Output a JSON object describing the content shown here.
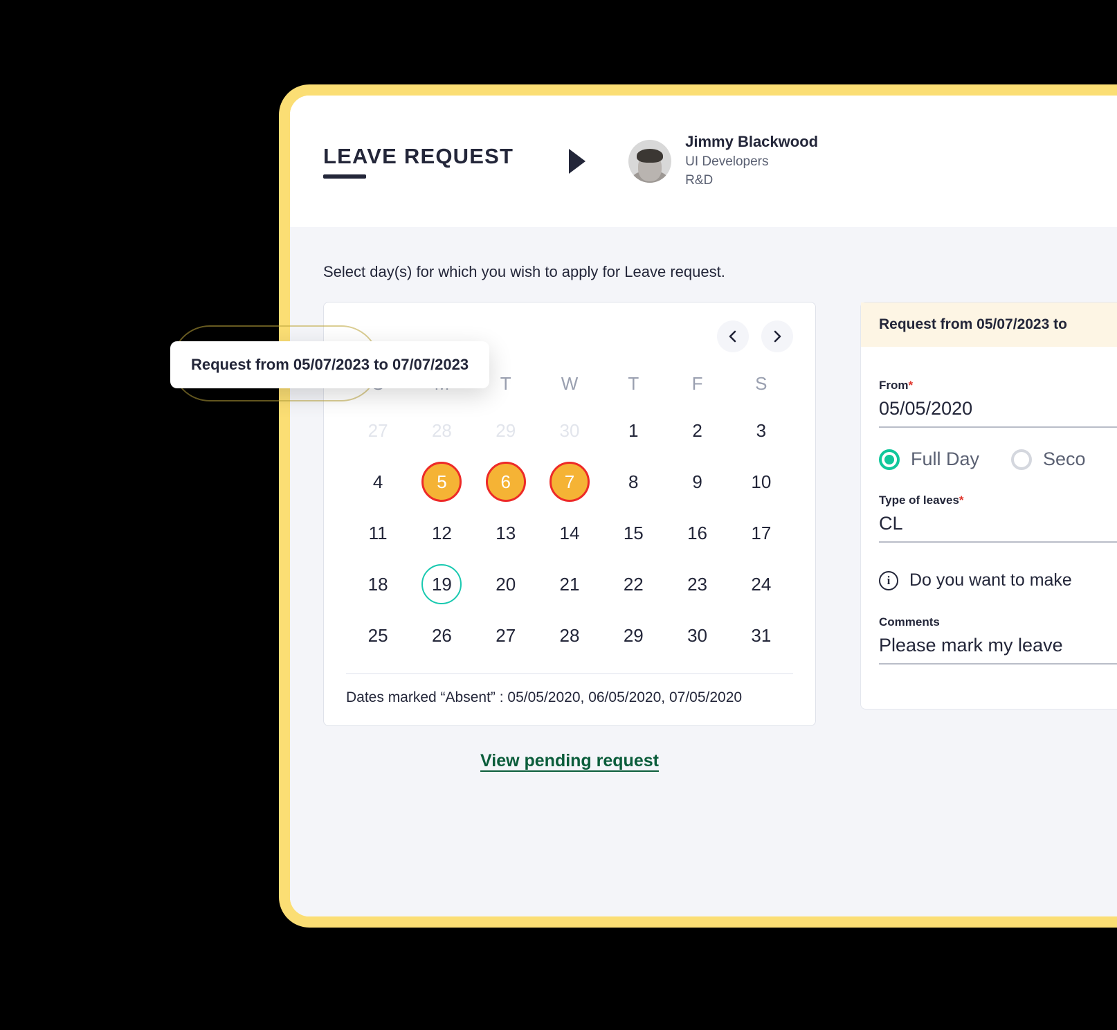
{
  "header": {
    "title": "LEAVE REQUEST",
    "marker_icon": "play-triangle-icon",
    "user": {
      "name": "Jimmy Blackwood",
      "role": "UI Developers",
      "department": "R&D"
    }
  },
  "instruction": "Select day(s) for which you wish to apply for Leave request.",
  "tooltip": {
    "text": "Request from 05/07/2023 to 07/07/2023"
  },
  "calendar": {
    "prev_icon": "chevron-left-icon",
    "next_icon": "chevron-right-icon",
    "weekdays": [
      "S",
      "M",
      "T",
      "W",
      "T",
      "F",
      "S"
    ],
    "weeks": [
      [
        {
          "n": "27",
          "state": "muted"
        },
        {
          "n": "28",
          "state": "muted"
        },
        {
          "n": "29",
          "state": "muted"
        },
        {
          "n": "30",
          "state": "muted"
        },
        {
          "n": "1",
          "state": "normal"
        },
        {
          "n": "2",
          "state": "normal"
        },
        {
          "n": "3",
          "state": "normal"
        }
      ],
      [
        {
          "n": "4",
          "state": "normal"
        },
        {
          "n": "5",
          "state": "selected"
        },
        {
          "n": "6",
          "state": "selected"
        },
        {
          "n": "7",
          "state": "selected"
        },
        {
          "n": "8",
          "state": "normal"
        },
        {
          "n": "9",
          "state": "normal"
        },
        {
          "n": "10",
          "state": "normal"
        }
      ],
      [
        {
          "n": "11",
          "state": "normal"
        },
        {
          "n": "12",
          "state": "normal"
        },
        {
          "n": "13",
          "state": "normal"
        },
        {
          "n": "14",
          "state": "normal"
        },
        {
          "n": "15",
          "state": "normal"
        },
        {
          "n": "16",
          "state": "normal"
        },
        {
          "n": "17",
          "state": "normal"
        }
      ],
      [
        {
          "n": "18",
          "state": "normal"
        },
        {
          "n": "19",
          "state": "today"
        },
        {
          "n": "20",
          "state": "normal"
        },
        {
          "n": "21",
          "state": "normal"
        },
        {
          "n": "22",
          "state": "normal"
        },
        {
          "n": "23",
          "state": "normal"
        },
        {
          "n": "24",
          "state": "normal"
        }
      ],
      [
        {
          "n": "25",
          "state": "normal"
        },
        {
          "n": "26",
          "state": "normal"
        },
        {
          "n": "27",
          "state": "normal"
        },
        {
          "n": "28",
          "state": "normal"
        },
        {
          "n": "29",
          "state": "normal"
        },
        {
          "n": "30",
          "state": "normal"
        },
        {
          "n": "31",
          "state": "normal"
        }
      ]
    ],
    "absent_line": "Dates marked “Absent” : 05/05/2020, 06/05/2020, 07/05/2020"
  },
  "form": {
    "banner": "Request from 05/07/2023 to",
    "from_label": "From",
    "from_required": "*",
    "from_value": "05/05/2020",
    "day_options": [
      {
        "label": "Full Day",
        "selected": true
      },
      {
        "label": "Seco",
        "selected": false
      }
    ],
    "type_label": "Type of leaves",
    "type_required": "*",
    "type_value": "CL",
    "info_icon": "info-circle-icon",
    "info_text": "Do you want to make",
    "comments_label": "Comments",
    "comments_value": "Please mark my leave"
  },
  "footer": {
    "pending_link": "View pending request"
  },
  "colors": {
    "frame": "#FBDE74",
    "selected_day_fill": "#F5B335",
    "selected_day_border": "#ED2A28",
    "today_ring": "#19C9B0",
    "radio_active": "#0FC79B",
    "link": "#0B5D3B",
    "banner_bg": "#FDF5E4"
  }
}
